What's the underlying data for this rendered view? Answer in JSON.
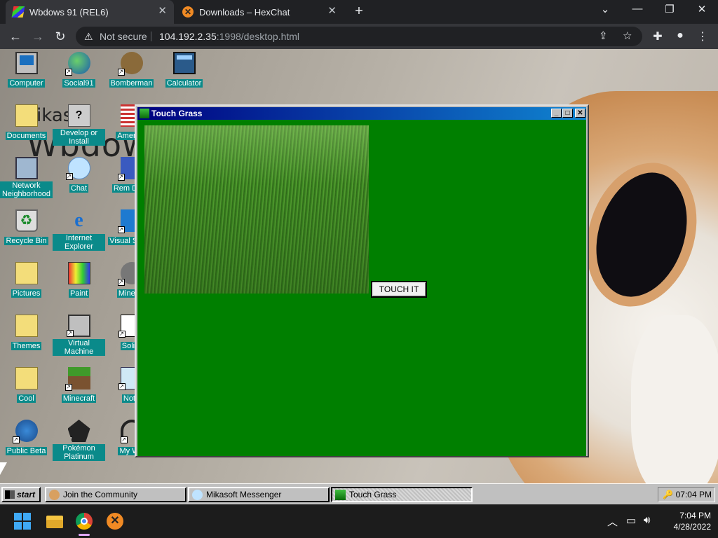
{
  "browser": {
    "tabs": [
      {
        "title": "Wbdows 91 (REL6)",
        "active": true,
        "icon": "windows-logo-icon"
      },
      {
        "title": "Downloads – HexChat",
        "active": false,
        "icon": "hexchat-icon"
      }
    ],
    "new_tab_symbol": "+",
    "security_label": "Not secure",
    "url_host": "104.192.2.35",
    "url_rest": ":1998/desktop.html"
  },
  "desktop": {
    "background_text_top": "ikaso",
    "background_text": "Wbdow",
    "icons": [
      {
        "label": "Computer",
        "icon": "computer-icon"
      },
      {
        "label": "Social91",
        "icon": "globe-icon"
      },
      {
        "label": "Bomberman",
        "icon": "bomberman-icon"
      },
      {
        "label": "Calculator",
        "icon": "calculator-icon"
      },
      {
        "label": "Documents",
        "icon": "documents-folder-icon"
      },
      {
        "label": "Develop or Install",
        "icon": "develop-icon"
      },
      {
        "label": "America",
        "icon": "us-flag-icon"
      },
      {
        "label": "Network Neighborhood",
        "icon": "network-icon"
      },
      {
        "label": "Chat",
        "icon": "chat-bubble-icon"
      },
      {
        "label": "Rem Desk",
        "icon": "remote-desktop-icon"
      },
      {
        "label": "Recycle Bin",
        "icon": "recycle-bin-icon"
      },
      {
        "label": "Internet Explorer",
        "icon": "internet-explorer-icon"
      },
      {
        "label": "Visual S Coc",
        "icon": "visual-studio-code-icon"
      },
      {
        "label": "Pictures",
        "icon": "folder-icon"
      },
      {
        "label": "Paint",
        "icon": "paint-icon"
      },
      {
        "label": "Minesw",
        "icon": "minesweeper-icon"
      },
      {
        "label": "Themes",
        "icon": "folder-icon"
      },
      {
        "label": "Virtual Machine",
        "icon": "virtual-machine-icon"
      },
      {
        "label": "Solita",
        "icon": "solitaire-icon"
      },
      {
        "label": "Cool",
        "icon": "folder-icon"
      },
      {
        "label": "Minecraft",
        "icon": "minecraft-icon"
      },
      {
        "label": "Note",
        "icon": "notepad-icon"
      },
      {
        "label": "Public Beta",
        "icon": "public-beta-icon"
      },
      {
        "label": "Pokémon Platinum",
        "icon": "pokemon-icon"
      },
      {
        "label": "My We",
        "icon": "headphones-icon"
      }
    ]
  },
  "window": {
    "title": "Touch Grass",
    "minimize_symbol": "_",
    "maximize_symbol": "□",
    "close_symbol": "✕",
    "button_label": "TOUCH IT",
    "background_color": "#007f00"
  },
  "taskbar": {
    "start_label": "start",
    "tasks": [
      {
        "label": "Join the Community",
        "pressed": false
      },
      {
        "label": "Mikasoft Messenger",
        "pressed": false
      },
      {
        "label": "Touch Grass",
        "pressed": true
      }
    ],
    "tray_time": "07:04 PM"
  },
  "os_taskbar": {
    "time": "7:04 PM",
    "date": "4/28/2022",
    "pinned": [
      "windows-start-icon",
      "file-explorer-icon",
      "chrome-icon",
      "hexchat-icon"
    ]
  }
}
